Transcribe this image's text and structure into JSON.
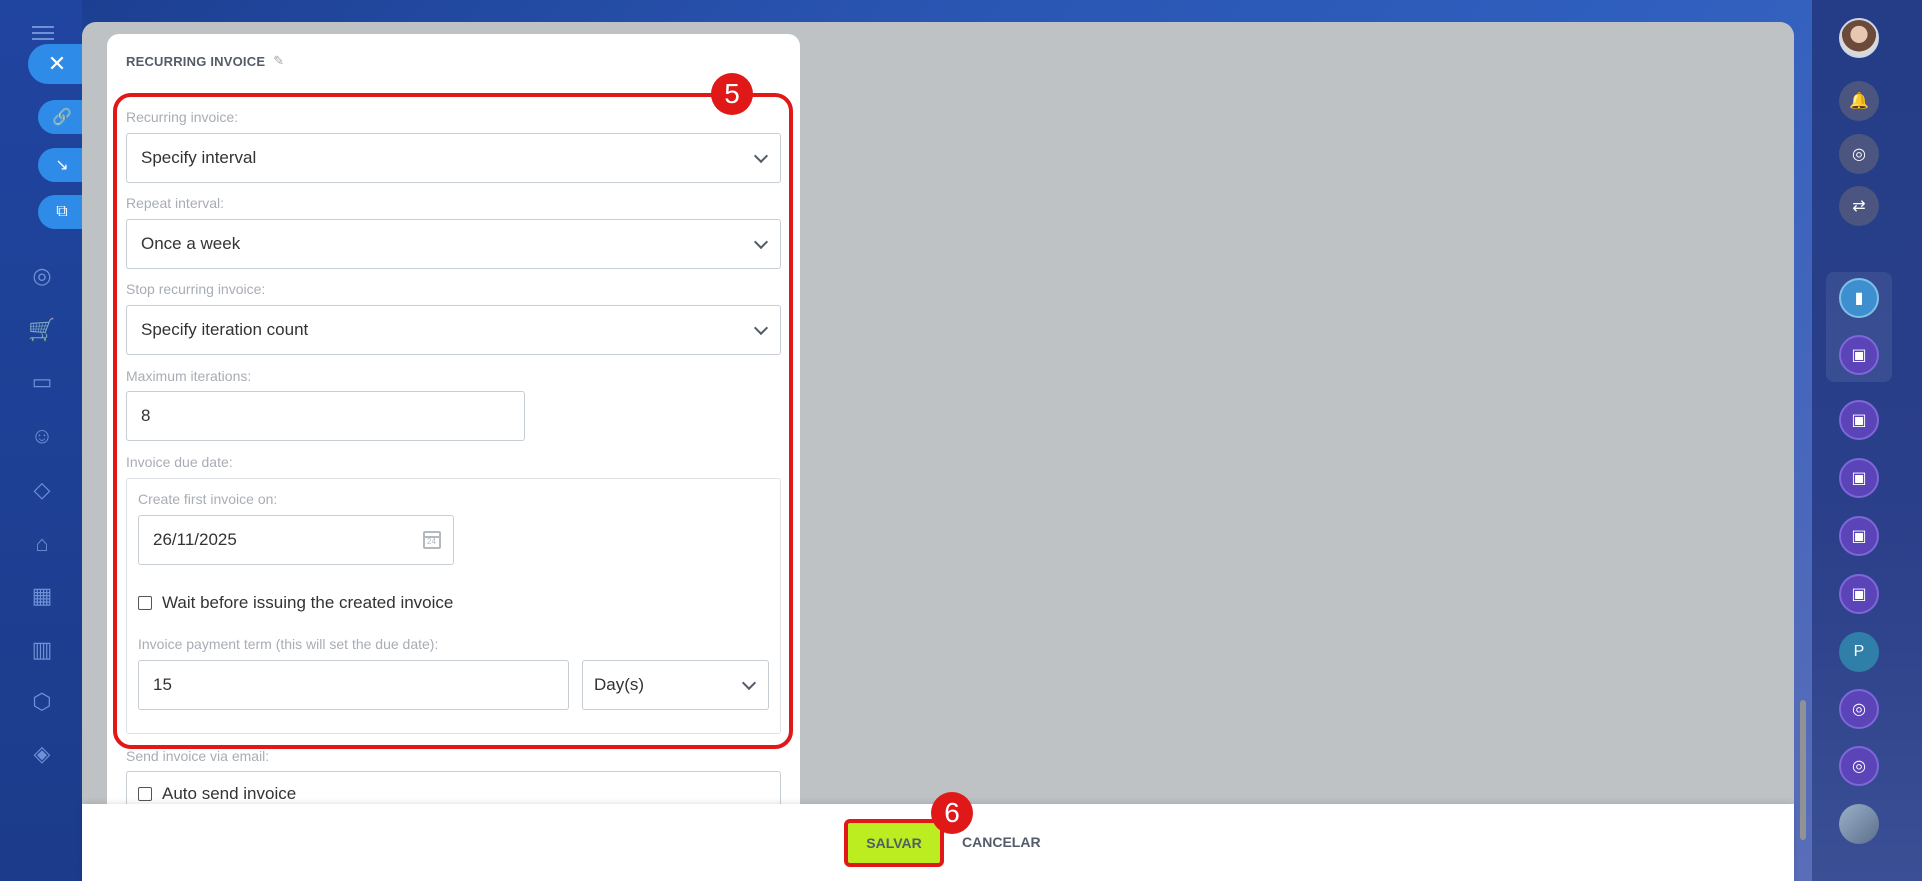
{
  "card": {
    "title": "RECURRING INVOICE"
  },
  "form": {
    "recurring_label": "Recurring invoice:",
    "recurring_value": "Specify interval",
    "repeat_label": "Repeat interval:",
    "repeat_value": "Once a week",
    "stop_label": "Stop recurring invoice:",
    "stop_value": "Specify iteration count",
    "max_label": "Maximum iterations:",
    "max_value": "8",
    "due_label": "Invoice due date:",
    "create_first_label": "Create first invoice on:",
    "create_first_value": "26/11/2025",
    "calendar_day": "24",
    "wait_label": "Wait before issuing the created invoice",
    "payment_term_label": "Invoice payment term (this will set the due date):",
    "payment_term_value": "15",
    "payment_term_unit": "Day(s)",
    "send_label": "Send invoice via email:",
    "auto_send_label": "Auto send invoice"
  },
  "annotations": {
    "badge_5": "5",
    "badge_6": "6"
  },
  "footer": {
    "save": "SALVAR",
    "cancel": "CANCELAR"
  },
  "right_rail": {
    "p_avatar": "P"
  },
  "colors": {
    "highlight": "#e01818",
    "save_button": "#bbed21",
    "panel_bg": "#bec2c4"
  }
}
